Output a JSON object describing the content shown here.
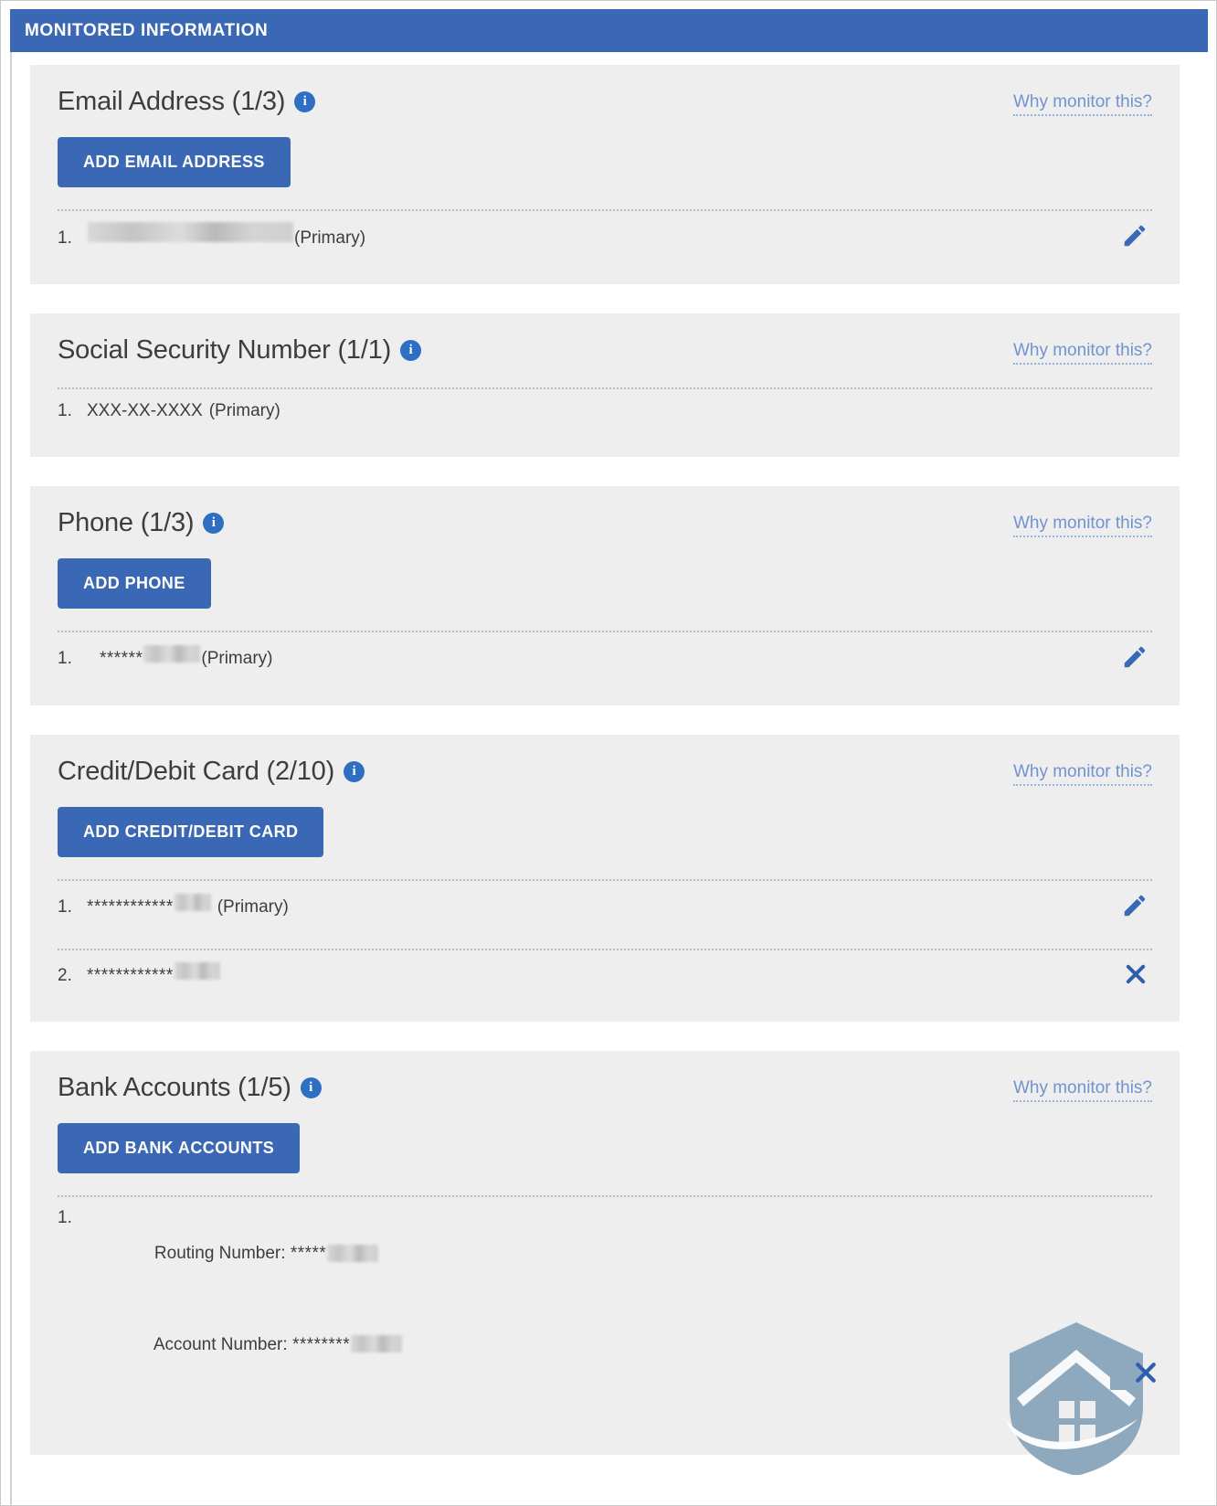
{
  "header": {
    "title": "MONITORED INFORMATION",
    "background": "#3a68b5",
    "text_color": "#ffffff"
  },
  "common": {
    "why_link": "Why monitor this?",
    "info_icon": "info-icon",
    "primary_suffix": "(Primary)",
    "accent": "#3a68b5",
    "link_color": "#6f94cf",
    "section_bg": "#eeeeee"
  },
  "sections": [
    {
      "id": "email-address",
      "title": "Email Address (1/3)",
      "count_current": 1,
      "count_max": 3,
      "why_link": "Why monitor this?",
      "add_button": "ADD EMAIL ADDRESS",
      "has_add_button": true,
      "entries": [
        {
          "number": "1.",
          "masked": "",
          "redacted": true,
          "suffix": "(Primary)",
          "action": "edit"
        }
      ]
    },
    {
      "id": "social-security-number",
      "title": "Social Security Number (1/1)",
      "count_current": 1,
      "count_max": 1,
      "why_link": "Why monitor this?",
      "add_button": "",
      "has_add_button": false,
      "entries": [
        {
          "number": "1.",
          "masked": "XXX-XX-XXXX",
          "redacted": false,
          "suffix": "(Primary)",
          "action": "none"
        }
      ]
    },
    {
      "id": "phone",
      "title": "Phone (1/3)",
      "count_current": 1,
      "count_max": 3,
      "why_link": "Why monitor this?",
      "add_button": "ADD PHONE",
      "has_add_button": true,
      "entries": [
        {
          "number": "1.",
          "masked": "******",
          "redacted": true,
          "suffix": "(Primary)",
          "action": "edit"
        }
      ]
    },
    {
      "id": "credit-debit-card",
      "title": "Credit/Debit Card (2/10)",
      "count_current": 2,
      "count_max": 10,
      "why_link": "Why monitor this?",
      "add_button": "ADD CREDIT/DEBIT CARD",
      "has_add_button": true,
      "entries": [
        {
          "number": "1.",
          "masked": "************",
          "redacted": true,
          "suffix": "(Primary)",
          "action": "edit"
        },
        {
          "number": "2.",
          "masked": "************",
          "redacted": true,
          "suffix": "",
          "action": "delete"
        }
      ]
    },
    {
      "id": "bank-accounts",
      "title": "Bank Accounts (1/5)",
      "count_current": 1,
      "count_max": 5,
      "why_link": "Why monitor this?",
      "add_button": "ADD BANK ACCOUNTS",
      "has_add_button": true,
      "entries": [
        {
          "number": "1.",
          "line1_label": "Routing Number:",
          "line1_masked": "*****",
          "line2_label": "Account Number:",
          "line2_masked": "********",
          "redacted": true,
          "suffix": "",
          "action": "delete"
        }
      ]
    }
  ],
  "watermark": {
    "name": "house-shield-logo",
    "color": "#8ea9bd"
  }
}
